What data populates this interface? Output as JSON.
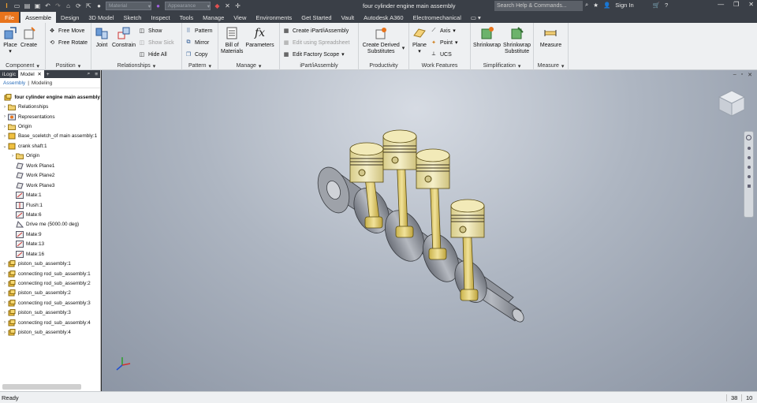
{
  "app": {
    "window_title": "four cylinder engine main assembly",
    "material_placeholder": "Material",
    "appearance_placeholder": "Appearance",
    "search_placeholder": "Search Help & Commands...",
    "sign_in": "Sign In"
  },
  "tabs": [
    {
      "label": "File"
    },
    {
      "label": "Assemble"
    },
    {
      "label": "Design"
    },
    {
      "label": "3D Model"
    },
    {
      "label": "Sketch"
    },
    {
      "label": "Inspect"
    },
    {
      "label": "Tools"
    },
    {
      "label": "Manage"
    },
    {
      "label": "View"
    },
    {
      "label": "Environments"
    },
    {
      "label": "Get Started"
    },
    {
      "label": "Vault"
    },
    {
      "label": "Autodesk A360"
    },
    {
      "label": "Electromechanical"
    }
  ],
  "ribbon": {
    "component": {
      "title": "Component",
      "place": "Place",
      "create": "Create"
    },
    "position": {
      "title": "Position",
      "free_move": "Free Move",
      "free_rotate": "Free Rotate"
    },
    "relationships": {
      "title": "Relationships",
      "joint": "Joint",
      "constrain": "Constrain",
      "show": "Show",
      "show_sick": "Show Sick",
      "hide_all": "Hide All"
    },
    "pattern": {
      "title": "Pattern",
      "pattern": "Pattern",
      "mirror": "Mirror",
      "copy": "Copy"
    },
    "manage": {
      "title": "Manage",
      "bill_of": "Bill of",
      "materials": "Materials",
      "parameters": "Parameters"
    },
    "ipart": {
      "title": "iPart/iAssembly",
      "create": "Create iPart/iAssembly",
      "edit_spreadsheet": "Edit using Spreadsheet",
      "edit_factory": "Edit Factory Scope"
    },
    "productivity": {
      "title": "Productivity",
      "create_derived": "Create Derived",
      "substitutes": "Substitutes"
    },
    "work_features": {
      "title": "Work Features",
      "plane": "Plane",
      "axis": "Axis",
      "point": "Point",
      "ucs": "UCS"
    },
    "simplification": {
      "title": "Simplification",
      "shrinkwrap": "Shrinkwrap",
      "shrinkwrap2": "Shrinkwrap",
      "substitute": "Substitute"
    },
    "measure": {
      "title": "Measure",
      "measure": "Measure"
    }
  },
  "browser": {
    "tab_ilogic": "iLogic",
    "tab_model": "Model",
    "sub_assembly": "Assembly",
    "sub_modeling": "Modeling",
    "nodes": [
      {
        "label": "four cylinder engine main assembly",
        "icon": "assembly-icon",
        "level": 0,
        "twist": ""
      },
      {
        "label": "Relationships",
        "icon": "folder-icon",
        "level": 0,
        "twist": ">"
      },
      {
        "label": "Representations",
        "icon": "representations-icon",
        "level": 0,
        "twist": ">"
      },
      {
        "label": "Origin",
        "icon": "folder-icon",
        "level": 0,
        "twist": ">"
      },
      {
        "label": "Base_sceletch_of main assembly:1",
        "icon": "part-icon",
        "level": 0,
        "twist": ">"
      },
      {
        "label": "crank shaft:1",
        "icon": "part-icon",
        "level": 0,
        "twist": "v"
      },
      {
        "label": "Origin",
        "icon": "folder-icon",
        "level": 1,
        "twist": ">"
      },
      {
        "label": "Work Plane1",
        "icon": "workplane-icon",
        "level": 1,
        "twist": ""
      },
      {
        "label": "Work Plane2",
        "icon": "workplane-icon",
        "level": 1,
        "twist": ""
      },
      {
        "label": "Work Plane3",
        "icon": "workplane-icon",
        "level": 1,
        "twist": ""
      },
      {
        "label": "Mate:1",
        "icon": "mate-icon",
        "level": 1,
        "twist": ""
      },
      {
        "label": "Flush:1",
        "icon": "flush-icon",
        "level": 1,
        "twist": ""
      },
      {
        "label": "Mate:6",
        "icon": "mate-icon",
        "level": 1,
        "twist": ""
      },
      {
        "label": "Drive me (5000.00 deg)",
        "icon": "angle-icon",
        "level": 1,
        "twist": ""
      },
      {
        "label": "Mate:9",
        "icon": "mate-icon",
        "level": 1,
        "twist": ""
      },
      {
        "label": "Mate:13",
        "icon": "mate-icon",
        "level": 1,
        "twist": ""
      },
      {
        "label": "Mate:16",
        "icon": "mate-icon",
        "level": 1,
        "twist": ""
      },
      {
        "label": "piston_sub_assembly:1",
        "icon": "assembly-icon",
        "level": 0,
        "twist": ">"
      },
      {
        "label": "connecting rod_sub_assembly:1",
        "icon": "assembly-icon",
        "level": 0,
        "twist": ">"
      },
      {
        "label": "connecting rod_sub_assembly:2",
        "icon": "assembly-icon",
        "level": 0,
        "twist": ">"
      },
      {
        "label": "piston_sub_assembly:2",
        "icon": "assembly-icon",
        "level": 0,
        "twist": ">"
      },
      {
        "label": "connecting rod_sub_assembly:3",
        "icon": "assembly-icon",
        "level": 0,
        "twist": ">"
      },
      {
        "label": "piston_sub_assembly:3",
        "icon": "assembly-icon",
        "level": 0,
        "twist": ">"
      },
      {
        "label": "connecting rod_sub_assembly:4",
        "icon": "assembly-icon",
        "level": 0,
        "twist": ">"
      },
      {
        "label": "piston_sub_assembly:4",
        "icon": "assembly-icon",
        "level": 0,
        "twist": ">"
      }
    ]
  },
  "status": {
    "text": "Ready",
    "num1": "38",
    "num2": "10"
  },
  "colors": {
    "accent": "#e8741c",
    "title_bar": "#3a3f47",
    "ribbon": "#eef0f2",
    "piston": "#efe5ae",
    "steel": "#8f939b"
  }
}
